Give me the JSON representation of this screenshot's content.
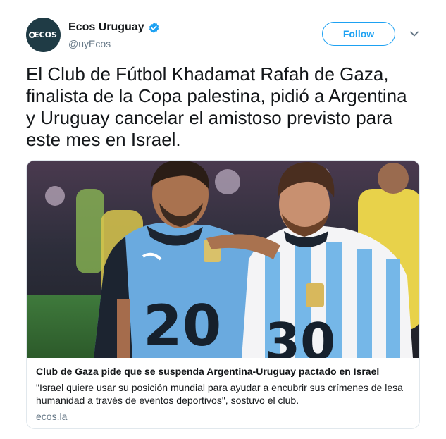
{
  "user": {
    "avatar_text": "ECOS",
    "display_name": "Ecos Uruguay",
    "verified": true,
    "handle": "@uyEcos"
  },
  "follow_label": "Follow",
  "tweet": {
    "text": "El Club de Fútbol Khadamat Rafah de Gaza, finalista de la Copa palestina, pidió a Argentina y Uruguay cancelar el amistoso previsto para este mes en Israel."
  },
  "card": {
    "title": "Club de Gaza pide que se suspenda Argentina-Uruguay pactado en Israel",
    "description": "\"Israel quiere usar su posición mundial para ayudar a encubrir sus crímenes de lesa humanidad a través de eventos deportivos\", sostuvo el club.",
    "domain": "ecos.la",
    "image": {
      "left_jersey_number": "20",
      "right_jersey_number": "30"
    }
  },
  "colors": {
    "accent": "#1da1f2",
    "text": "#14171a",
    "muted": "#657786",
    "border": "#e1e8ed",
    "uruguay_blue": "#6aaadf",
    "argentina_blue": "#75b7e8"
  },
  "icons": {
    "verified": "verified-badge-icon",
    "caret": "chevron-down-icon"
  }
}
